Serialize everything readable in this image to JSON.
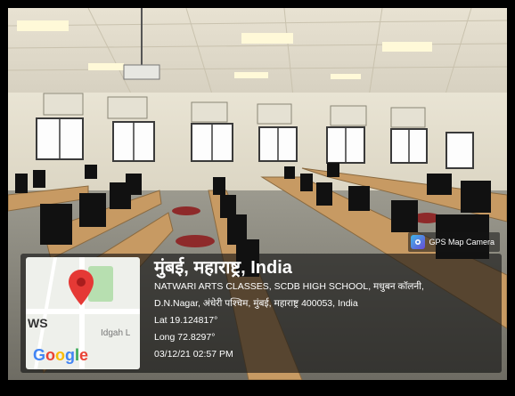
{
  "badge": {
    "label": "GPS Map Camera",
    "icon": "gps-camera-icon"
  },
  "map": {
    "label_left": "WS",
    "label_right": "Idgah L",
    "logo": "Google",
    "pin_icon": "map-pin-icon"
  },
  "location": {
    "title": "मुंबई, महाराष्ट्र, India",
    "address_line1": "NATWARI ARTS CLASSES, SCDB HIGH SCHOOL, मधुबन कॉलनी,",
    "address_line2": "D.N.Nagar, अंधेरी पश्चिम, मुंबई, महाराष्ट्र 400053, India",
    "lat": "Lat 19.124817°",
    "long": "Long 72.8297°",
    "timestamp": "03/12/21 02:57 PM"
  },
  "colors": {
    "overlay": "#121212",
    "pin": "#e53935",
    "desk": "#c79a63"
  }
}
